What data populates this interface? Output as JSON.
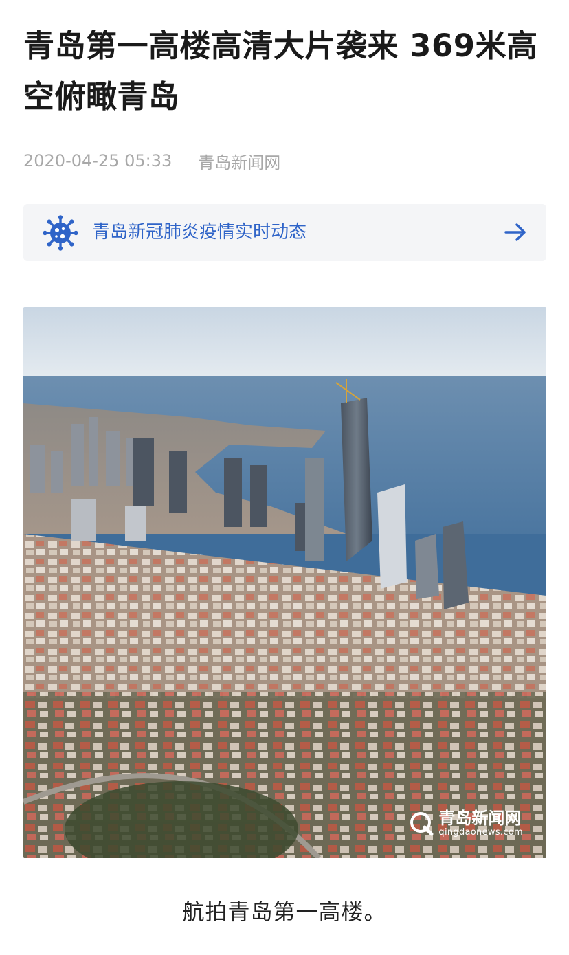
{
  "article": {
    "title": "青岛第一高楼高清大片袭来 369米高空俯瞰青岛",
    "date": "2020-04-25 05:33",
    "source": "青岛新闻网"
  },
  "banner": {
    "label": "青岛新冠肺炎疫情实时动态",
    "icon": "virus-icon",
    "arrow_icon": "arrow-right-icon",
    "accent_color": "#2f64c8"
  },
  "photo": {
    "watermark_name": "青岛新闻网",
    "watermark_url": "qingdaonews.com"
  },
  "caption": "航拍青岛第一高楼。"
}
